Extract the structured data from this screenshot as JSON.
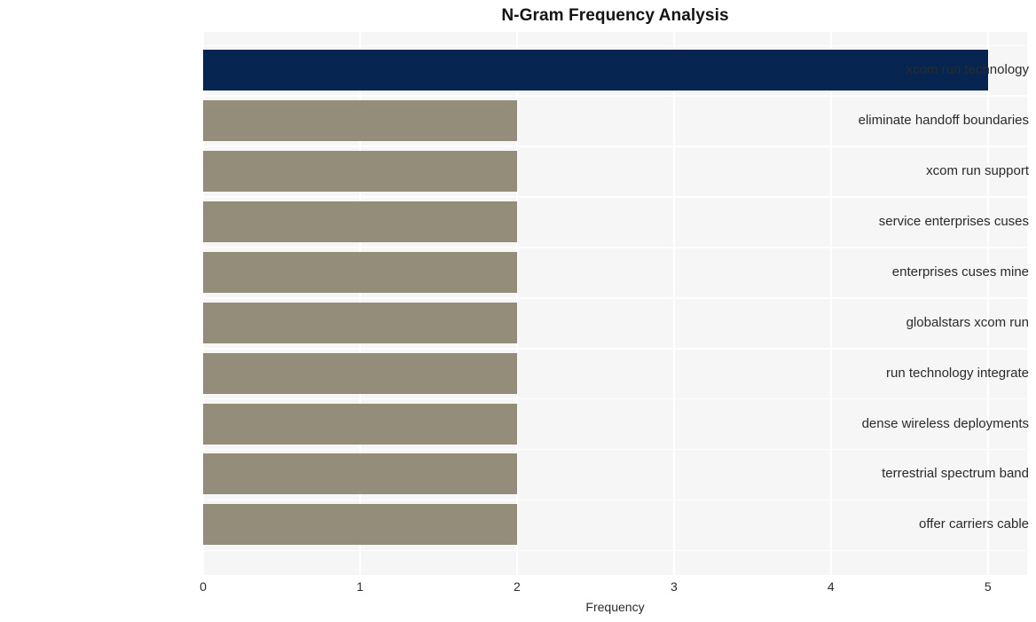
{
  "chart_data": {
    "type": "bar",
    "orientation": "horizontal",
    "title": "N-Gram Frequency Analysis",
    "xlabel": "Frequency",
    "ylabel": "",
    "xlim": [
      0,
      5.25
    ],
    "xticks": [
      "0",
      "1",
      "2",
      "3",
      "4",
      "5"
    ],
    "xtick_values": [
      0,
      1,
      2,
      3,
      4,
      5
    ],
    "grid": true,
    "legend": null,
    "categories": [
      "xcom run technology",
      "eliminate handoff boundaries",
      "xcom run support",
      "service enterprises cuses",
      "enterprises cuses mine",
      "globalstars xcom run",
      "run technology integrate",
      "dense wireless deployments",
      "terrestrial spectrum band",
      "offer carriers cable"
    ],
    "values": [
      5,
      2,
      2,
      2,
      2,
      2,
      2,
      2,
      2,
      2
    ],
    "bar_colors": [
      "#062651",
      "#948d79",
      "#948d79",
      "#948d79",
      "#948d79",
      "#948d79",
      "#948d79",
      "#948d79",
      "#948d79",
      "#948d79"
    ]
  },
  "style": {
    "plot_background": "#f6f6f7",
    "grid_color": "#ffffff",
    "figure_background": "#ffffff",
    "title_color": "#141414",
    "tick_color": "#2b2b2b",
    "highlight_color": "#062651",
    "bar_color": "#948d79"
  }
}
